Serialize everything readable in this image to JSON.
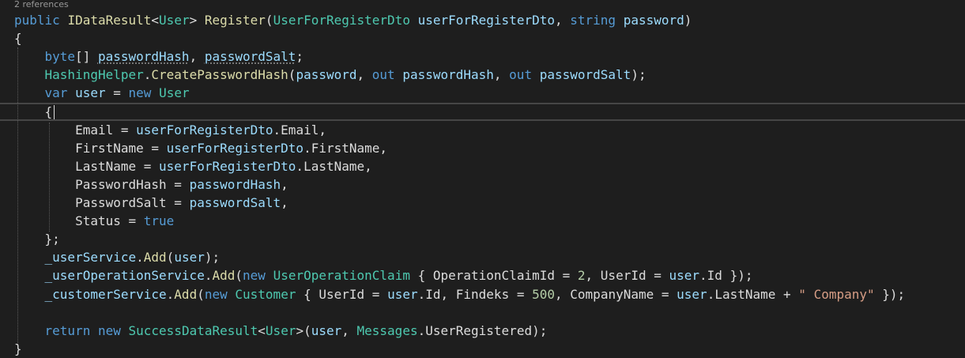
{
  "editor": {
    "codelens": "2 references",
    "lines": [
      [
        {
          "t": "public",
          "c": "kw"
        },
        {
          "t": " ",
          "c": "pu"
        },
        {
          "t": "IDataResult",
          "c": "fn"
        },
        {
          "t": "<",
          "c": "pu"
        },
        {
          "t": "User",
          "c": "ty"
        },
        {
          "t": ">",
          "c": "pu"
        },
        {
          "t": " ",
          "c": "pu"
        },
        {
          "t": "Register",
          "c": "fn"
        },
        {
          "t": "(",
          "c": "pu"
        },
        {
          "t": "UserForRegisterDto",
          "c": "ty"
        },
        {
          "t": " ",
          "c": "pu"
        },
        {
          "t": "userForRegisterDto",
          "c": "var"
        },
        {
          "t": ", ",
          "c": "pu"
        },
        {
          "t": "string",
          "c": "kw"
        },
        {
          "t": " ",
          "c": "pu"
        },
        {
          "t": "password",
          "c": "var"
        },
        {
          "t": ")",
          "c": "pu"
        }
      ],
      [
        {
          "t": "{",
          "c": "pu"
        }
      ],
      [
        {
          "t": "    ",
          "c": "pu"
        },
        {
          "t": "byte",
          "c": "kw"
        },
        {
          "t": "[] ",
          "c": "pu"
        },
        {
          "t": "passwordHash",
          "c": "var squig"
        },
        {
          "t": ", ",
          "c": "pu"
        },
        {
          "t": "passwordSalt",
          "c": "var squig"
        },
        {
          "t": ";",
          "c": "pu"
        }
      ],
      [
        {
          "t": "    ",
          "c": "pu"
        },
        {
          "t": "HashingHelper",
          "c": "ty"
        },
        {
          "t": ".",
          "c": "pu"
        },
        {
          "t": "CreatePasswordHash",
          "c": "fn"
        },
        {
          "t": "(",
          "c": "pu"
        },
        {
          "t": "password",
          "c": "var"
        },
        {
          "t": ", ",
          "c": "pu"
        },
        {
          "t": "out",
          "c": "kw"
        },
        {
          "t": " ",
          "c": "pu"
        },
        {
          "t": "passwordHash",
          "c": "var"
        },
        {
          "t": ", ",
          "c": "pu"
        },
        {
          "t": "out",
          "c": "kw"
        },
        {
          "t": " ",
          "c": "pu"
        },
        {
          "t": "passwordSalt",
          "c": "var"
        },
        {
          "t": ");",
          "c": "pu"
        }
      ],
      [
        {
          "t": "    ",
          "c": "pu"
        },
        {
          "t": "var",
          "c": "kw"
        },
        {
          "t": " ",
          "c": "pu"
        },
        {
          "t": "user",
          "c": "var"
        },
        {
          "t": " = ",
          "c": "pu"
        },
        {
          "t": "new",
          "c": "kw"
        },
        {
          "t": " ",
          "c": "pu"
        },
        {
          "t": "User",
          "c": "ty"
        }
      ],
      [
        {
          "t": "    ",
          "c": "pu"
        },
        {
          "t": "{",
          "c": "pu"
        }
      ],
      [
        {
          "t": "        ",
          "c": "pu"
        },
        {
          "t": "Email",
          "c": "id"
        },
        {
          "t": " = ",
          "c": "pu"
        },
        {
          "t": "userForRegisterDto",
          "c": "var"
        },
        {
          "t": ".",
          "c": "pu"
        },
        {
          "t": "Email",
          "c": "id"
        },
        {
          "t": ",",
          "c": "pu"
        }
      ],
      [
        {
          "t": "        ",
          "c": "pu"
        },
        {
          "t": "FirstName",
          "c": "id"
        },
        {
          "t": " = ",
          "c": "pu"
        },
        {
          "t": "userForRegisterDto",
          "c": "var"
        },
        {
          "t": ".",
          "c": "pu"
        },
        {
          "t": "FirstName",
          "c": "id"
        },
        {
          "t": ",",
          "c": "pu"
        }
      ],
      [
        {
          "t": "        ",
          "c": "pu"
        },
        {
          "t": "LastName",
          "c": "id"
        },
        {
          "t": " = ",
          "c": "pu"
        },
        {
          "t": "userForRegisterDto",
          "c": "var"
        },
        {
          "t": ".",
          "c": "pu"
        },
        {
          "t": "LastName",
          "c": "id"
        },
        {
          "t": ",",
          "c": "pu"
        }
      ],
      [
        {
          "t": "        ",
          "c": "pu"
        },
        {
          "t": "PasswordHash",
          "c": "id"
        },
        {
          "t": " = ",
          "c": "pu"
        },
        {
          "t": "passwordHash",
          "c": "var"
        },
        {
          "t": ",",
          "c": "pu"
        }
      ],
      [
        {
          "t": "        ",
          "c": "pu"
        },
        {
          "t": "PasswordSalt",
          "c": "id"
        },
        {
          "t": " = ",
          "c": "pu"
        },
        {
          "t": "passwordSalt",
          "c": "var"
        },
        {
          "t": ",",
          "c": "pu"
        }
      ],
      [
        {
          "t": "        ",
          "c": "pu"
        },
        {
          "t": "Status",
          "c": "id"
        },
        {
          "t": " = ",
          "c": "pu"
        },
        {
          "t": "true",
          "c": "kw"
        }
      ],
      [
        {
          "t": "    ",
          "c": "pu"
        },
        {
          "t": "};",
          "c": "pu"
        }
      ],
      [
        {
          "t": "    ",
          "c": "pu"
        },
        {
          "t": "_userService",
          "c": "var"
        },
        {
          "t": ".",
          "c": "pu"
        },
        {
          "t": "Add",
          "c": "fn"
        },
        {
          "t": "(",
          "c": "pu"
        },
        {
          "t": "user",
          "c": "var"
        },
        {
          "t": ");",
          "c": "pu"
        }
      ],
      [
        {
          "t": "    ",
          "c": "pu"
        },
        {
          "t": "_userOperationService",
          "c": "var"
        },
        {
          "t": ".",
          "c": "pu"
        },
        {
          "t": "Add",
          "c": "fn"
        },
        {
          "t": "(",
          "c": "pu"
        },
        {
          "t": "new",
          "c": "kw"
        },
        {
          "t": " ",
          "c": "pu"
        },
        {
          "t": "UserOperationClaim",
          "c": "ty"
        },
        {
          "t": " { ",
          "c": "pu"
        },
        {
          "t": "OperationClaimId",
          "c": "id"
        },
        {
          "t": " = ",
          "c": "pu"
        },
        {
          "t": "2",
          "c": "num"
        },
        {
          "t": ", ",
          "c": "pu"
        },
        {
          "t": "UserId",
          "c": "id"
        },
        {
          "t": " = ",
          "c": "pu"
        },
        {
          "t": "user",
          "c": "var"
        },
        {
          "t": ".",
          "c": "pu"
        },
        {
          "t": "Id",
          "c": "id"
        },
        {
          "t": " });",
          "c": "pu"
        }
      ],
      [
        {
          "t": "    ",
          "c": "pu"
        },
        {
          "t": "_customerService",
          "c": "var"
        },
        {
          "t": ".",
          "c": "pu"
        },
        {
          "t": "Add",
          "c": "fn"
        },
        {
          "t": "(",
          "c": "pu"
        },
        {
          "t": "new",
          "c": "kw"
        },
        {
          "t": " ",
          "c": "pu"
        },
        {
          "t": "Customer",
          "c": "ty"
        },
        {
          "t": " { ",
          "c": "pu"
        },
        {
          "t": "UserId",
          "c": "id"
        },
        {
          "t": " = ",
          "c": "pu"
        },
        {
          "t": "user",
          "c": "var"
        },
        {
          "t": ".",
          "c": "pu"
        },
        {
          "t": "Id",
          "c": "id"
        },
        {
          "t": ", ",
          "c": "pu"
        },
        {
          "t": "Findeks",
          "c": "id"
        },
        {
          "t": " = ",
          "c": "pu"
        },
        {
          "t": "500",
          "c": "num"
        },
        {
          "t": ", ",
          "c": "pu"
        },
        {
          "t": "CompanyName",
          "c": "id"
        },
        {
          "t": " = ",
          "c": "pu"
        },
        {
          "t": "user",
          "c": "var"
        },
        {
          "t": ".",
          "c": "pu"
        },
        {
          "t": "LastName",
          "c": "id"
        },
        {
          "t": " + ",
          "c": "pu"
        },
        {
          "t": "\" Company\"",
          "c": "str"
        },
        {
          "t": " });",
          "c": "pu"
        }
      ],
      [],
      [
        {
          "t": "    ",
          "c": "pu"
        },
        {
          "t": "return",
          "c": "kw"
        },
        {
          "t": " ",
          "c": "pu"
        },
        {
          "t": "new",
          "c": "kw"
        },
        {
          "t": " ",
          "c": "pu"
        },
        {
          "t": "SuccessDataResult",
          "c": "ty"
        },
        {
          "t": "<",
          "c": "pu"
        },
        {
          "t": "User",
          "c": "ty"
        },
        {
          "t": ">(",
          "c": "pu"
        },
        {
          "t": "user",
          "c": "var"
        },
        {
          "t": ", ",
          "c": "pu"
        },
        {
          "t": "Messages",
          "c": "ty"
        },
        {
          "t": ".",
          "c": "pu"
        },
        {
          "t": "UserRegistered",
          "c": "id"
        },
        {
          "t": ");",
          "c": "pu"
        }
      ],
      [
        {
          "t": "}",
          "c": "pu"
        }
      ]
    ]
  }
}
